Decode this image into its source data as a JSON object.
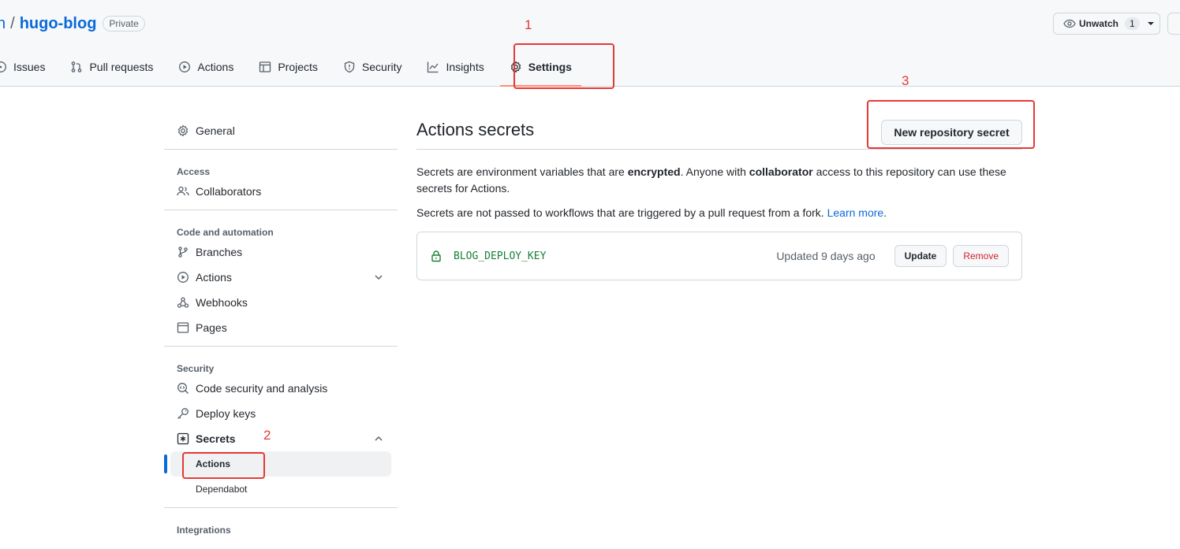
{
  "header": {
    "owner_fragment": "n",
    "separator": "/",
    "repo_name": "hugo-blog",
    "visibility_badge": "Private",
    "unwatch_label": "Unwatch",
    "watch_count": "1"
  },
  "tabs": [
    {
      "label": "Issues",
      "icon": "issue-opened-icon"
    },
    {
      "label": "Pull requests",
      "icon": "git-pull-request-icon"
    },
    {
      "label": "Actions",
      "icon": "play-icon"
    },
    {
      "label": "Projects",
      "icon": "table-icon"
    },
    {
      "label": "Security",
      "icon": "shield-icon"
    },
    {
      "label": "Insights",
      "icon": "graph-icon"
    },
    {
      "label": "Settings",
      "icon": "gear-icon",
      "active": true
    }
  ],
  "sidebar": {
    "general": "General",
    "access_heading": "Access",
    "collaborators": "Collaborators",
    "code_heading": "Code and automation",
    "branches": "Branches",
    "actions": "Actions",
    "webhooks": "Webhooks",
    "pages": "Pages",
    "security_heading": "Security",
    "code_security": "Code security and analysis",
    "deploy_keys": "Deploy keys",
    "secrets": "Secrets",
    "secrets_actions": "Actions",
    "secrets_dependabot": "Dependabot",
    "integrations_heading": "Integrations"
  },
  "main": {
    "title": "Actions secrets",
    "new_secret_button": "New repository secret",
    "desc_part1": "Secrets are environment variables that are ",
    "desc_bold1": "encrypted",
    "desc_part2": ". Anyone with ",
    "desc_bold2": "collaborator",
    "desc_part3": " access to this repository can use these secrets for Actions.",
    "fork_note": "Secrets are not passed to workflows that are triggered by a pull request from a fork. ",
    "learn_more": "Learn more",
    "period": ".",
    "secrets": [
      {
        "name": "BLOG_DEPLOY_KEY",
        "updated": "Updated 9 days ago",
        "update_label": "Update",
        "remove_label": "Remove"
      }
    ]
  },
  "annotations": {
    "one": "1",
    "two": "2",
    "three": "3",
    "color": "#e53935"
  }
}
